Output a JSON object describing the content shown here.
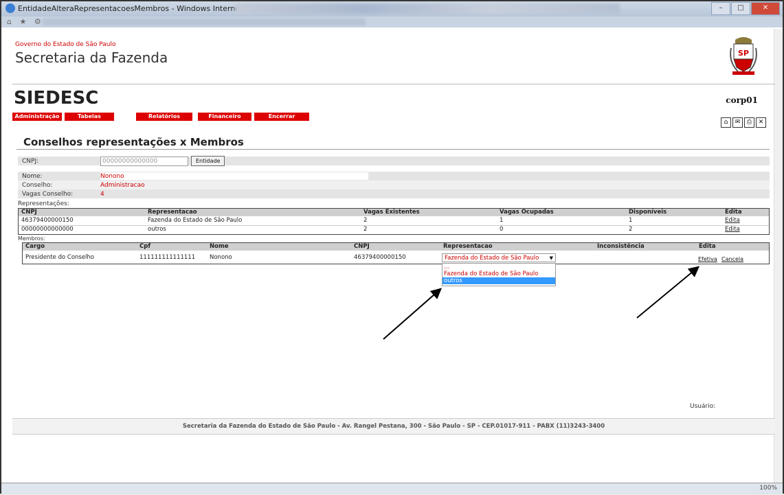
{
  "window": {
    "title": "EntidadeAlteraRepresentacoesMembros - Windows Internet Explorer",
    "fav_icons": "⌂ ★ ⚙",
    "controls": {
      "minimize": "–",
      "maximize": "□",
      "close": "✕"
    },
    "zoom": "100%"
  },
  "header": {
    "gov_text": "Governo do Estado de São Paulo",
    "sec_text": "Secretaria da Fazenda",
    "app_name": "SIEDESC",
    "user_code": "corp01",
    "seal_text": "SP"
  },
  "menu": {
    "items": [
      "Administração",
      "Tabelas",
      "Relatórios",
      "Financeiro",
      "Encerrar"
    ]
  },
  "toolbar_icons": [
    "home-icon",
    "mail-icon",
    "print-icon",
    "close-icon"
  ],
  "toolbar_glyphs": [
    "⌂",
    "✉",
    "⎙",
    "✕"
  ],
  "page_title": "Conselhos representações x Membros",
  "form": {
    "cnpj_label": "CNPJ:",
    "cnpj_placeholder": "00000000000000",
    "entidade_button": "Entidade",
    "nome_label": "Nome:",
    "nome_value": "Nonono",
    "conselho_label": "Conselho:",
    "conselho_value": "Administracao",
    "vagas_label": "Vagas Conselho:",
    "vagas_value": "4"
  },
  "representacoes": {
    "label": "Representações:",
    "headers": [
      "CNPJ",
      "Representacao",
      "Vagas Existentes",
      "Vagas Ocupadas",
      "Disponíveis",
      "Edita"
    ],
    "rows": [
      [
        "46379400000150",
        "Fazenda do Estado de São Paulo",
        "2",
        "1",
        "1",
        "Edita"
      ],
      [
        "00000000000000",
        "outros",
        "2",
        "0",
        "2",
        "Edita"
      ]
    ]
  },
  "membros": {
    "label": "Membros:",
    "headers": [
      "Cargo",
      "Cpf",
      "Nome",
      "CNPJ",
      "Representacao",
      "Inconsistência",
      "Edita"
    ],
    "row": {
      "cargo": "Presidente do Conselho",
      "cpf": "111111111111111",
      "nome": "Nonono",
      "cnpj": "46379400000150",
      "representacao_selected": "Fazenda do Estado de São Paulo",
      "inconsistencia": "",
      "efetiva": "Efetiva",
      "cancela": "Cancela"
    },
    "dropdown_options": [
      "...",
      "Fazenda do Estado de São Paulo",
      "outros"
    ],
    "dropdown_highlighted": "outros"
  },
  "usuario_label": "Usuário:",
  "footer": "Secretaria da Fazenda do Estado de São Paulo - Av. Rangel Pestana, 300 - São Paulo - SP - CEP.01017-911 - PABX (11)3243-3400"
}
